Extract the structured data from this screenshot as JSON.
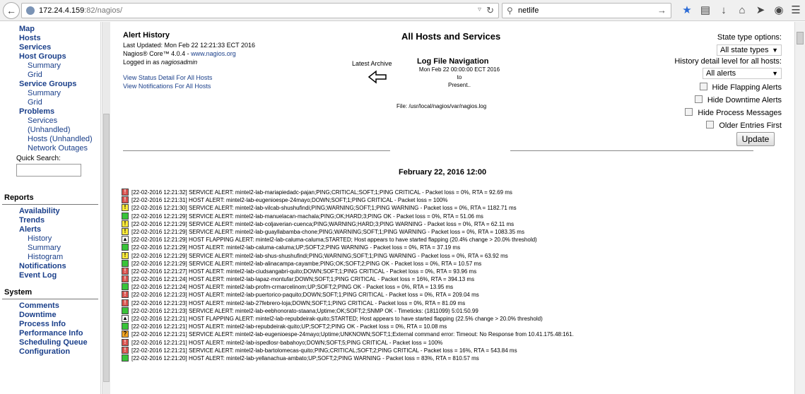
{
  "browser": {
    "url_host": "172.24.4.159",
    "url_path": ":82/nagios/",
    "search_text": "netlife"
  },
  "sidebar": {
    "top_items": [
      {
        "label": "Map",
        "type": "head"
      },
      {
        "label": "Hosts",
        "type": "head"
      },
      {
        "label": "Services",
        "type": "head"
      },
      {
        "label": "Host Groups",
        "type": "head"
      },
      {
        "label": "Summary",
        "type": "sub"
      },
      {
        "label": "Grid",
        "type": "sub"
      },
      {
        "label": "Service Groups",
        "type": "head"
      },
      {
        "label": "Summary",
        "type": "sub"
      },
      {
        "label": "Grid",
        "type": "sub"
      },
      {
        "label": "Problems",
        "type": "head"
      },
      {
        "label": "Services",
        "type": "sub"
      },
      {
        "label": "(Unhandled)",
        "type": "sub"
      },
      {
        "label": "Hosts (Unhandled)",
        "type": "sub"
      },
      {
        "label": "Network Outages",
        "type": "sub"
      }
    ],
    "quick_search_label": "Quick Search:",
    "reports_title": "Reports",
    "reports_items": [
      {
        "label": "Availability",
        "type": "head"
      },
      {
        "label": "Trends",
        "type": "head"
      },
      {
        "label": "Alerts",
        "type": "head"
      },
      {
        "label": "History",
        "type": "sub"
      },
      {
        "label": "Summary",
        "type": "sub"
      },
      {
        "label": "Histogram",
        "type": "sub"
      },
      {
        "label": "Notifications",
        "type": "head"
      },
      {
        "label": "Event Log",
        "type": "head"
      }
    ],
    "system_title": "System",
    "system_items": [
      {
        "label": "Comments",
        "type": "head"
      },
      {
        "label": "Downtime",
        "type": "head"
      },
      {
        "label": "Process Info",
        "type": "head"
      },
      {
        "label": "Performance Info",
        "type": "head"
      },
      {
        "label": "Scheduling Queue",
        "type": "head"
      },
      {
        "label": "Configuration",
        "type": "head"
      }
    ]
  },
  "header": {
    "title": "Alert History",
    "last_updated": "Last Updated: Mon Feb 22 12:21:33 ECT 2016",
    "version_prefix": "Nagios® Core™ 4.0.4 - ",
    "version_link": "www.nagios.org",
    "logged_in_prefix": "Logged in as ",
    "logged_in_user": "nagiosadmin",
    "link_status": "View Status Detail For All Hosts",
    "link_notifications": "View Notifications For All Hosts",
    "page_title": "All Hosts and Services",
    "latest_archive": "Latest Archive",
    "lognav_title": "Log File Navigation",
    "lognav_date": "Mon Feb 22 00:00:00 ECT 2016",
    "lognav_to": "to",
    "lognav_present": "Present..",
    "file_line": "File: /usr/local/nagios/var/nagios.log"
  },
  "options": {
    "state_type_label": "State type options:",
    "state_type_value": "All state types",
    "detail_label": "History detail level for all hosts:",
    "detail_value": "All alerts",
    "hide_flapping": "Hide Flapping Alerts",
    "hide_downtime": "Hide Downtime Alerts",
    "hide_process": "Hide Process Messages",
    "older_first": "Older Entries First",
    "update_label": "Update"
  },
  "log": {
    "date_heading": "February 22, 2016 12:00",
    "entries": [
      {
        "state": "crit",
        "icon": "!",
        "text": "[22-02-2016 12:21:32] SERVICE ALERT: mintel2-lab-mariapiedadc-pajan;PING;CRITICAL;SOFT;1;PING CRITICAL - Packet loss = 0%, RTA = 92.69 ms"
      },
      {
        "state": "crit",
        "icon": "!",
        "text": "[22-02-2016 12:21:31] HOST ALERT: mintel2-lab-eugenioespe-24mayo;DOWN;SOFT;1;PING CRITICAL - Packet loss = 100%"
      },
      {
        "state": "warn",
        "icon": "!",
        "text": "[22-02-2016 12:21:30] SERVICE ALERT: mintel2-lab-vilcab-shushufindi;PING;WARNING;SOFT;1;PING WARNING - Packet loss = 0%, RTA = 1182.71 ms"
      },
      {
        "state": "ok",
        "icon": "",
        "text": "[22-02-2016 12:21:29] SERVICE ALERT: mintel2-lab-manuelacan-machala;PING;OK;HARD;3;PING OK - Packet loss = 0%, RTA = 51.06 ms"
      },
      {
        "state": "warn",
        "icon": "!",
        "text": "[22-02-2016 12:21:29] SERVICE ALERT: mintel2-lab-coljaverian-cuenca;PING;WARNING;HARD;3;PING WARNING - Packet loss = 0%, RTA = 62.11 ms"
      },
      {
        "state": "warn",
        "icon": "!",
        "text": "[22-02-2016 12:21:29] SERVICE ALERT: mintel2-lab-guayllabamba-chone;PING;WARNING;SOFT;1;PING WARNING - Packet loss = 0%, RTA = 1083.35 ms"
      },
      {
        "state": "flap",
        "icon": "▲",
        "text": "[22-02-2016 12:21:29] HOST FLAPPING ALERT: mintel2-lab-caluma-caluma;STARTED; Host appears to have started flapping (20.4% change > 20.0% threshold)"
      },
      {
        "state": "ok",
        "icon": "",
        "text": "[22-02-2016 12:21:29] HOST ALERT: mintel2-lab-caluma-caluma;UP;SOFT;2;PING WARNING - Packet loss = 0%, RTA = 37.19 ms"
      },
      {
        "state": "warn",
        "icon": "!",
        "text": "[22-02-2016 12:21:29] SERVICE ALERT: mintel2-lab-shus-shushufindi;PING;WARNING;SOFT;1;PING WARNING - Packet loss = 0%, RTA = 63.92 ms"
      },
      {
        "state": "ok",
        "icon": "",
        "text": "[22-02-2016 12:21:29] SERVICE ALERT: mintel2-lab-alinacampa-cayambe;PING;OK;SOFT;2;PING OK - Packet loss = 0%, RTA = 10.57 ms"
      },
      {
        "state": "crit",
        "icon": "!",
        "text": "[22-02-2016 12:21:27] HOST ALERT: mintel2-lab-ciudsangabri-quito;DOWN;SOFT;1;PING CRITICAL - Packet loss = 0%, RTA = 93.96 ms"
      },
      {
        "state": "crit",
        "icon": "!",
        "text": "[22-02-2016 12:21:24] HOST ALERT: mintel2-lab-lapaz-montufar;DOWN;SOFT;1;PING CRITICAL - Packet loss = 16%, RTA = 394.13 ms"
      },
      {
        "state": "ok",
        "icon": "",
        "text": "[22-02-2016 12:21:24] HOST ALERT: mintel2-lab-profm-crmarcelinom;UP;SOFT;2;PING OK - Packet loss = 0%, RTA = 13.95 ms"
      },
      {
        "state": "crit",
        "icon": "!",
        "text": "[22-02-2016 12:21:23] HOST ALERT: mintel2-lab-puertorico-paquito;DOWN;SOFT;1;PING CRITICAL - Packet loss = 0%, RTA = 209.04 ms"
      },
      {
        "state": "crit",
        "icon": "!",
        "text": "[22-02-2016 12:21:23] HOST ALERT: mintel2-lab-27febrero-loja;DOWN;SOFT;1;PING CRITICAL - Packet loss = 0%, RTA = 81.09 ms"
      },
      {
        "state": "ok",
        "icon": "",
        "text": "[22-02-2016 12:21:23] SERVICE ALERT: mintel2-lab-eebhonorato-staana;Uptime;OK;SOFT;2;SNMP OK - Timeticks: (1811099) 5:01:50.99"
      },
      {
        "state": "flap",
        "icon": "▲",
        "text": "[22-02-2016 12:21:21] HOST FLAPPING ALERT: mintel2-lab-repubdeirak-quito;STARTED; Host appears to have started flapping (22.5% change > 20.0% threshold)"
      },
      {
        "state": "ok",
        "icon": "",
        "text": "[22-02-2016 12:21:21] HOST ALERT: mintel2-lab-repubdeirak-quito;UP;SOFT;2;PING OK - Packet loss = 0%, RTA = 10.08 ms"
      },
      {
        "state": "unk",
        "icon": "?",
        "text": "[22-02-2016 12:21:21] SERVICE ALERT: mintel2-lab-eugenioespe-24mayo;Uptime;UNKNOWN;SOFT;1;External command error: Timeout: No Response from 10.41.175.48:161."
      },
      {
        "state": "crit",
        "icon": "!",
        "text": "[22-02-2016 12:21:21] HOST ALERT: mintel2-lab-ispedlosr-babahoyo;DOWN;SOFT;5;PING CRITICAL - Packet loss = 100%"
      },
      {
        "state": "crit",
        "icon": "!",
        "text": "[22-02-2016 12:21:21] SERVICE ALERT: mintel2-lab-bartolomecas-quito;PING;CRITICAL;SOFT;2;PING CRITICAL - Packet loss = 16%, RTA = 543.84 ms"
      },
      {
        "state": "ok",
        "icon": "",
        "text": "[22-02-2016 12:21:20] HOST ALERT: mintel2-lab-yellanachua-ambato;UP;SOFT;2;PING WARNING - Packet loss = 83%, RTA = 810.57 ms"
      }
    ]
  }
}
